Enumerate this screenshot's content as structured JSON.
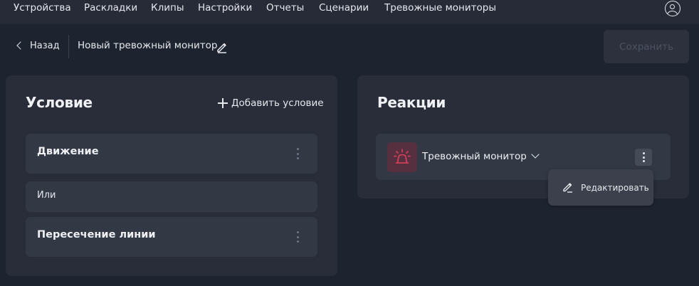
{
  "nav": {
    "items": [
      "Устройства",
      "Раскладки",
      "Клипы",
      "Настройки",
      "Отчеты",
      "Сценарии",
      "Тревожные мониторы"
    ]
  },
  "header": {
    "back_label": "Назад",
    "title": "Новый тревожный монитор",
    "save_label": "Сохранить"
  },
  "conditions": {
    "title": "Условие",
    "add_label": "Добавить условие",
    "items": [
      "Движение",
      "Пересечение линии"
    ],
    "separator": "Или"
  },
  "reactions": {
    "title": "Реакции",
    "item_label": "Тревожный монитор",
    "menu_edit_label": "Редактировать"
  },
  "colors": {
    "accent": "#e0405e",
    "icon_bg": "#56303f"
  }
}
